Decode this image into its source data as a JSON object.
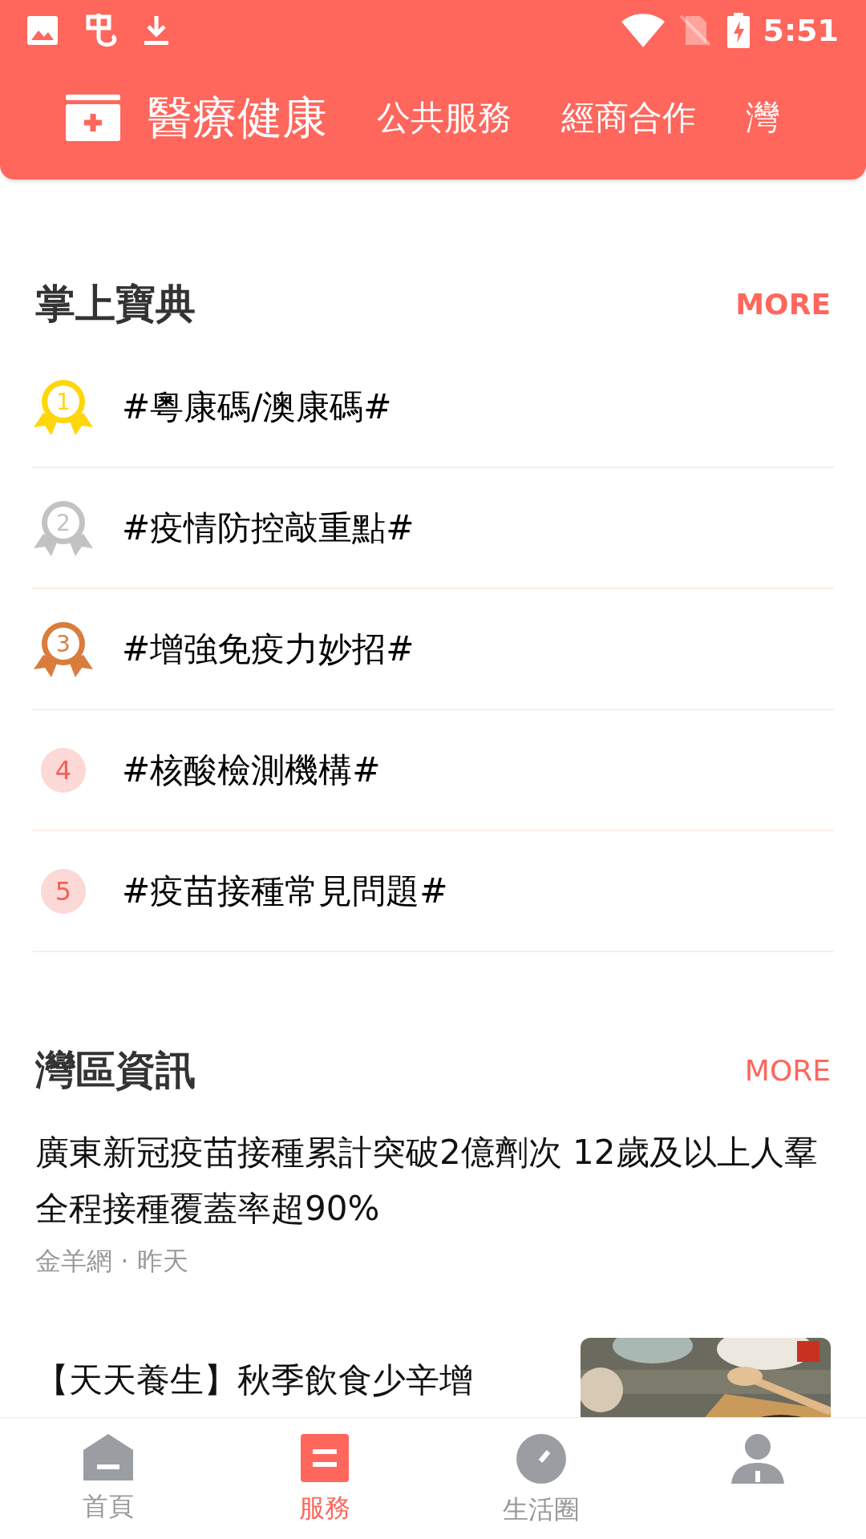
{
  "status_bar": {
    "time": "5:51"
  },
  "header": {
    "tabs": [
      {
        "label": "醫療健康",
        "selected": true
      },
      {
        "label": "公共服務",
        "selected": false
      },
      {
        "label": "經商合作",
        "selected": false
      },
      {
        "label": "灣",
        "selected": false
      }
    ]
  },
  "handbook": {
    "title": "掌上寶典",
    "more": "MORE",
    "items": [
      {
        "rank": "1",
        "kind": "medal",
        "color": "#ffd60a",
        "title": "#粵康碼/澳康碼#"
      },
      {
        "rank": "2",
        "kind": "medal",
        "color": "#c2c2c2",
        "title": "#疫情防控敲重點#"
      },
      {
        "rank": "3",
        "kind": "medal",
        "color": "#d97c3c",
        "title": "#增強免疫力妙招#"
      },
      {
        "rank": "4",
        "kind": "badge",
        "color": "#f4605a",
        "title": "#核酸檢測機構#"
      },
      {
        "rank": "5",
        "kind": "badge",
        "color": "#f4605a",
        "title": "#疫苗接種常見問題#"
      }
    ]
  },
  "bay_news": {
    "title": "灣區資訊",
    "more": "MORE",
    "articles": [
      {
        "title": "廣東新冠疫苗接種累計突破2億劑次 12歲及以上人羣全程接種覆蓋率超90%",
        "source": "金羊網 · 昨天"
      },
      {
        "title": "【天天養生】秋季飲食少辛增"
      }
    ]
  },
  "bottom_nav": [
    {
      "label": "首頁",
      "selected": false
    },
    {
      "label": "服務",
      "selected": true
    },
    {
      "label": "生活圈",
      "selected": false
    },
    {
      "selected": false
    }
  ]
}
